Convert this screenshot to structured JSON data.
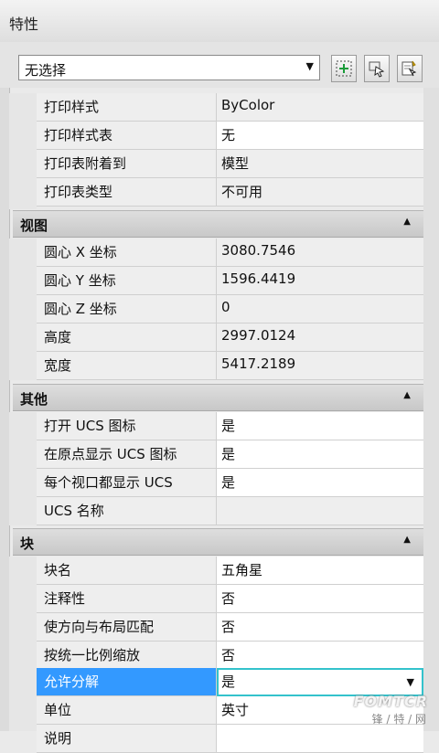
{
  "title": "特性",
  "selection": {
    "value": "无选择"
  },
  "sections": [
    {
      "label": null,
      "rows": [
        {
          "key": "打印样式",
          "value": "ByColor"
        },
        {
          "key": "打印样式表",
          "value": "无"
        },
        {
          "key": "打印表附着到",
          "value": "模型"
        },
        {
          "key": "打印表类型",
          "value": "不可用"
        }
      ]
    },
    {
      "label": "视图",
      "rows": [
        {
          "key": "圆心 X 坐标",
          "value": "3080.7546"
        },
        {
          "key": "圆心 Y 坐标",
          "value": "1596.4419"
        },
        {
          "key": "圆心 Z 坐标",
          "value": "0"
        },
        {
          "key": "高度",
          "value": "2997.0124"
        },
        {
          "key": "宽度",
          "value": "5417.2189"
        }
      ]
    },
    {
      "label": "其他",
      "rows": [
        {
          "key": "打开 UCS 图标",
          "value": "是"
        },
        {
          "key": "在原点显示 UCS 图标",
          "value": "是"
        },
        {
          "key": "每个视口都显示 UCS",
          "value": "是"
        },
        {
          "key": "UCS 名称",
          "value": ""
        }
      ]
    },
    {
      "label": "块",
      "rows": [
        {
          "key": "块名",
          "value": "五角星"
        },
        {
          "key": "注释性",
          "value": "否"
        },
        {
          "key": "使方向与布局匹配",
          "value": "否"
        },
        {
          "key": "按统一比例缩放",
          "value": "否"
        },
        {
          "key": "允许分解",
          "value": "是"
        },
        {
          "key": "单位",
          "value": "英寸"
        },
        {
          "key": "说明",
          "value": ""
        }
      ]
    }
  ],
  "watermark": {
    "logo": "FOMTCR",
    "sub": "锋 / 特 / 网"
  }
}
